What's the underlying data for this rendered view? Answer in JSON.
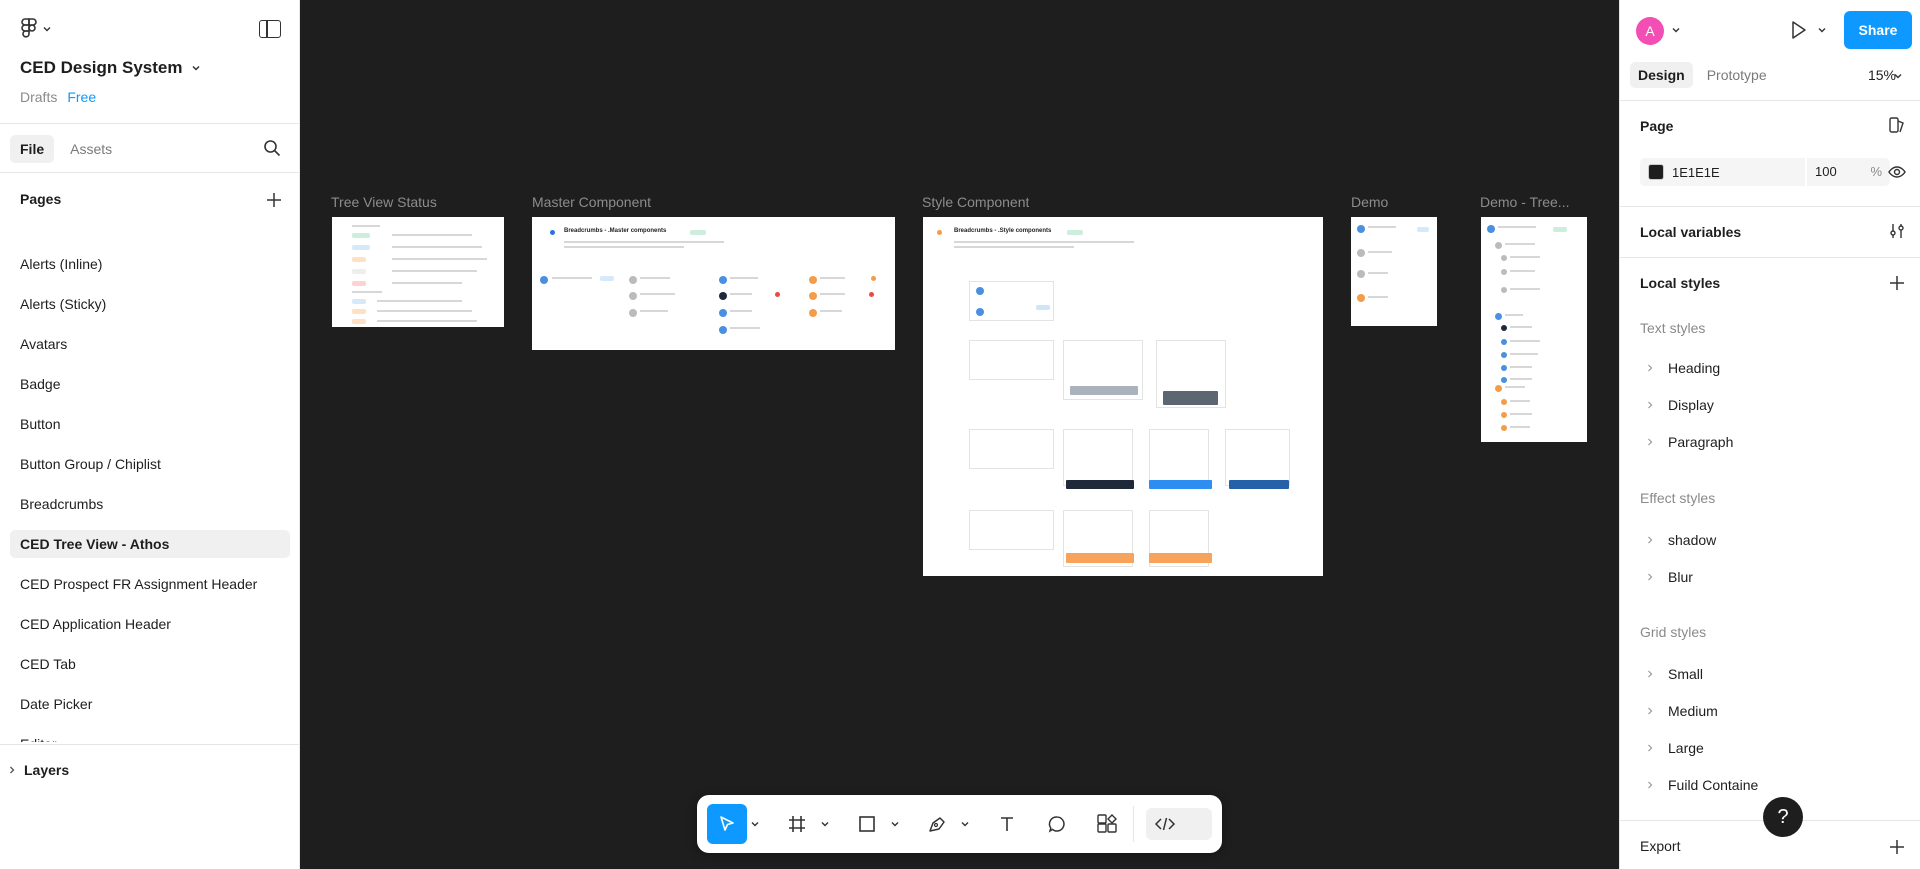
{
  "colors": {
    "accent": "#0d99ff",
    "canvas": "#1e1e1e",
    "avatar": "#f24eb4",
    "plan": "#0d99ff"
  },
  "left": {
    "file_title": "CED Design System",
    "drafts": "Drafts",
    "plan": "Free",
    "tabs": [
      {
        "label": "File"
      },
      {
        "label": "Assets"
      }
    ],
    "pages_label": "Pages",
    "pages": [
      {
        "label": "Alerts (Inline)"
      },
      {
        "label": "Alerts (Sticky)"
      },
      {
        "label": "Avatars"
      },
      {
        "label": "Badge"
      },
      {
        "label": "Button"
      },
      {
        "label": "Button Group / Chiplist"
      },
      {
        "label": "Breadcrumbs"
      },
      {
        "label": "CED Tree View - Athos"
      },
      {
        "label": "CED Prospect FR Assignment Header"
      },
      {
        "label": "CED Application Header"
      },
      {
        "label": "CED Tab"
      },
      {
        "label": "Date Picker"
      },
      {
        "label": "Editor"
      }
    ],
    "layers_label": "Layers"
  },
  "canvas": {
    "frames": [
      {
        "label": "Tree View Status"
      },
      {
        "label": "Master Component"
      },
      {
        "label": "Style Component"
      },
      {
        "label": "Demo"
      },
      {
        "label": "Demo - Tree..."
      }
    ],
    "master_title": "Breadcrumbs - .Master components",
    "style_title": "Breadcrumbs - .Style components"
  },
  "right": {
    "avatar_initial": "A",
    "share": "Share",
    "tabs": [
      {
        "label": "Design"
      },
      {
        "label": "Prototype"
      }
    ],
    "zoom": "15%",
    "page_label": "Page",
    "fill_hex": "1E1E1E",
    "fill_opacity": "100",
    "fill_pct": "%",
    "local_variables": "Local variables",
    "local_styles": "Local styles",
    "text_styles_label": "Text styles",
    "text_styles": [
      {
        "label": "Heading"
      },
      {
        "label": "Display"
      },
      {
        "label": "Paragraph"
      }
    ],
    "effect_styles_label": "Effect styles",
    "effect_styles": [
      {
        "label": "shadow"
      },
      {
        "label": "Blur"
      }
    ],
    "grid_styles_label": "Grid styles",
    "grid_styles": [
      {
        "label": "Small"
      },
      {
        "label": "Medium"
      },
      {
        "label": "Large"
      },
      {
        "label": "Fuild Containe"
      }
    ],
    "export_label": "Export",
    "help": "?"
  }
}
